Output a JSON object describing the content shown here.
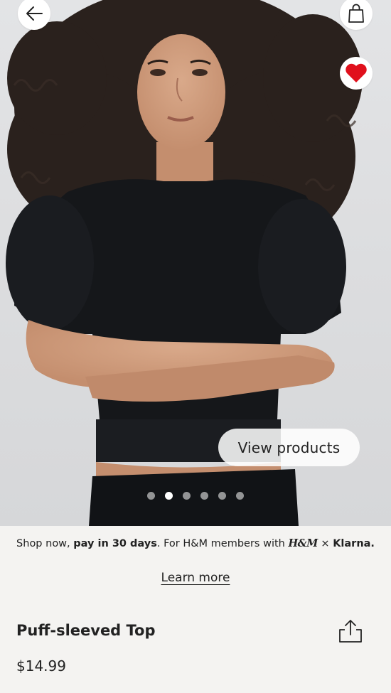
{
  "hero": {
    "view_products_label": "View products",
    "carousel": {
      "count": 6,
      "active_index": 1
    }
  },
  "icons": {
    "back": "arrow-left-icon",
    "bag": "shopping-bag-icon",
    "favorite": "heart-icon",
    "share": "share-icon"
  },
  "colors": {
    "favorite_heart": "#e0101c",
    "background": "#f4f3f1"
  },
  "payment_banner": {
    "text_start": "Shop now, ",
    "text_bold": "pay in 30 days",
    "text_mid": ". For H&M members with ",
    "hm_logo": "H&M",
    "separator": " × ",
    "klarna_logo": "Klarna."
  },
  "learn_more_label": "Learn more",
  "product": {
    "title": "Puff-sleeved Top",
    "price": "$14.99"
  }
}
